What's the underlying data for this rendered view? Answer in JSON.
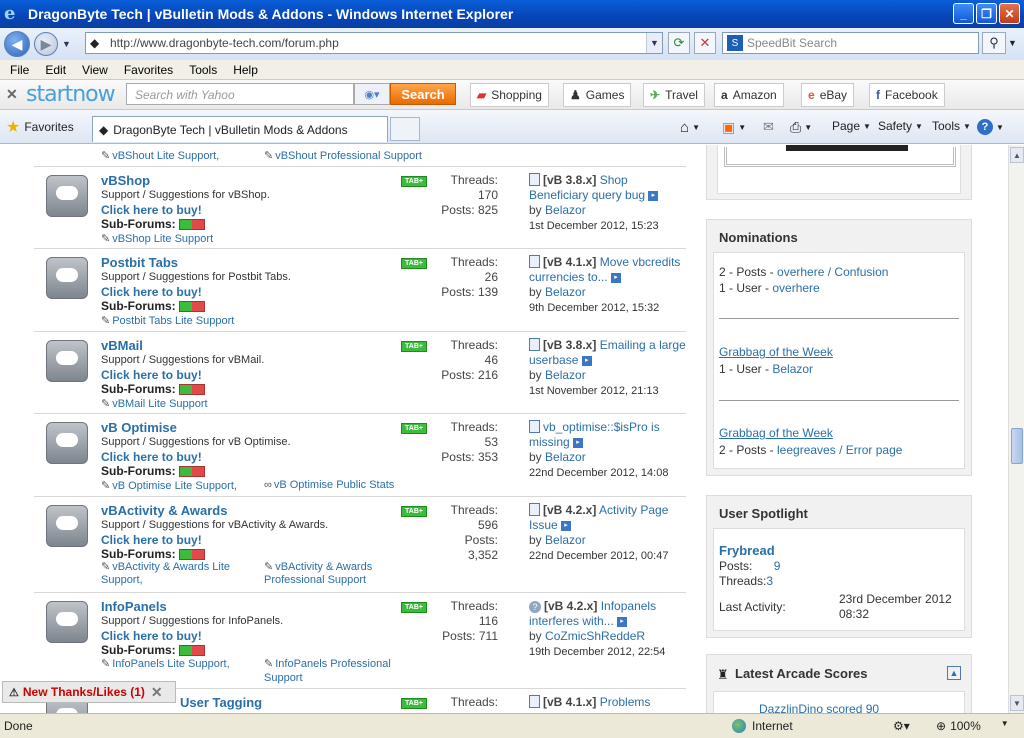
{
  "window": {
    "title": "DragonByte Tech | vBulletin Mods & Addons - Windows Internet Explorer"
  },
  "nav": {
    "url": "http://www.dragonbyte-tech.com/forum.php",
    "search_placeholder": "SpeedBit Search"
  },
  "menu": {
    "items": [
      "File",
      "Edit",
      "View",
      "Favorites",
      "Tools",
      "Help"
    ]
  },
  "startnow": {
    "logo": "startnow",
    "search_placeholder": "Search with Yahoo",
    "search_button": "Search",
    "links": [
      "Shopping",
      "Games",
      "Travel",
      "Amazon",
      "eBay",
      "Facebook"
    ]
  },
  "tabs": {
    "favorites": "Favorites",
    "active_tab": "DragonByte Tech | vBulletin Mods & Addons",
    "commands": [
      "Page",
      "Safety",
      "Tools"
    ]
  },
  "top_subforums": [
    "vBShout Lite Support,",
    "vBShout Professional Support"
  ],
  "forums": [
    {
      "title": "vBShop",
      "desc": "Support / Suggestions for vBShop.",
      "buy": "Click here to buy!",
      "sub_label": "Sub-Forums:",
      "badge": "TAB+",
      "subforums": [
        "vBShop Lite Support"
      ],
      "threads_label": "Threads:",
      "threads": "170",
      "posts_label": "Posts:",
      "posts": "825",
      "lp_prefix": "[vB 3.8.x]",
      "lp_title": "Shop Beneficiary query bug",
      "lp_by": "by",
      "lp_user": "Belazor",
      "lp_date": "1st December 2012, 15:23"
    },
    {
      "title": "Postbit Tabs",
      "desc": "Support / Suggestions for Postbit Tabs.",
      "buy": "Click here to buy!",
      "sub_label": "Sub-Forums:",
      "badge": "TAB+",
      "subforums": [
        "Postbit Tabs Lite Support"
      ],
      "threads_label": "Threads:",
      "threads": "26",
      "posts_label": "Posts:",
      "posts": "139",
      "lp_prefix": "[vB 4.1.x]",
      "lp_title": "Move vbcredits currencies to...",
      "lp_by": "by",
      "lp_user": "Belazor",
      "lp_date": "9th December 2012, 15:32"
    },
    {
      "title": "vBMail",
      "desc": "Support / Suggestions for vBMail.",
      "buy": "Click here to buy!",
      "sub_label": "Sub-Forums:",
      "badge": "TAB+",
      "subforums": [
        "vBMail Lite Support"
      ],
      "threads_label": "Threads:",
      "threads": "46",
      "posts_label": "Posts:",
      "posts": "216",
      "lp_prefix": "[vB 3.8.x]",
      "lp_title": "Emailing a large userbase",
      "lp_by": "by",
      "lp_user": "Belazor",
      "lp_date": "1st November 2012, 21:13"
    },
    {
      "title": "vB Optimise",
      "desc": "Support / Suggestions for vB Optimise.",
      "buy": "Click here to buy!",
      "sub_label": "Sub-Forums:",
      "badge": "TAB+",
      "subforums": [
        "vB Optimise Lite Support,",
        "vB Optimise Public Stats"
      ],
      "threads_label": "Threads:",
      "threads": "53",
      "posts_label": "Posts:",
      "posts": "353",
      "lp_prefix": "",
      "lp_title": "vb_optimise::$isPro is missing",
      "lp_by": "by",
      "lp_user": "Belazor",
      "lp_date": "22nd December 2012, 14:08"
    },
    {
      "title": "vBActivity & Awards",
      "desc": "Support / Suggestions for vBActivity & Awards.",
      "buy": "Click here to buy!",
      "sub_label": "Sub-Forums:",
      "badge": "TAB+",
      "subforums": [
        "vBActivity & Awards Lite Support,",
        "vBActivity & Awards Professional Support"
      ],
      "threads_label": "Threads:",
      "threads": "596",
      "posts_label": "Posts:",
      "posts": "3,352",
      "lp_prefix": "[vB 4.2.x]",
      "lp_title": "Activity Page Issue",
      "lp_by": "by",
      "lp_user": "Belazor",
      "lp_date": "22nd December 2012, 00:47"
    },
    {
      "title": "InfoPanels",
      "desc": "Support / Suggestions for InfoPanels.",
      "buy": "Click here to buy!",
      "sub_label": "Sub-Forums:",
      "badge": "TAB+",
      "subforums": [
        "InfoPanels Lite Support,",
        "InfoPanels Professional Support"
      ],
      "threads_label": "Threads:",
      "threads": "116",
      "posts_label": "Posts:",
      "posts": "711",
      "lp_prefix": "[vB 4.2.x]",
      "lp_title": "Infopanels interferes with...",
      "lp_by": "by",
      "lp_user": "CoZmicShReddeR",
      "lp_date": "19th December 2012, 22:54"
    },
    {
      "title": "User Tagging",
      "badge": "TAB+",
      "threads_label": "Threads:",
      "lp_prefix": "[vB 4.1.x]",
      "lp_title": "Problems"
    }
  ],
  "sidebar": {
    "nominations": {
      "title": "Nominations",
      "line1_prefix": "2 - Posts - ",
      "line1_user": "overhere",
      "line1_sep": " / ",
      "line1_thread": "Confusion",
      "line2_prefix": "1 - User - ",
      "line2_user": "overhere",
      "grab1_title": "Grabbag of the Week",
      "grab1_prefix": "1 - User - ",
      "grab1_user": "Belazor",
      "grab2_title": "Grabbag of the Week",
      "grab2_prefix": "2 - Posts - ",
      "grab2_user": "leegreaves",
      "grab2_sep": " / ",
      "grab2_thread": "Error page"
    },
    "spotlight": {
      "title": "User Spotlight",
      "name": "Frybread",
      "posts_label": "Posts:",
      "posts": "9",
      "threads_label": "Threads:",
      "threads": "3",
      "activity_label": "Last Activity:",
      "activity": "23rd December 2012 08:32"
    },
    "arcade": {
      "title": "Latest Arcade Scores",
      "entry": "DazzlinDino scored 90"
    }
  },
  "thanks": {
    "label": "New Thanks/Likes (1)"
  },
  "status": {
    "left": "Done",
    "zone": "Internet",
    "zoom": "100%"
  }
}
